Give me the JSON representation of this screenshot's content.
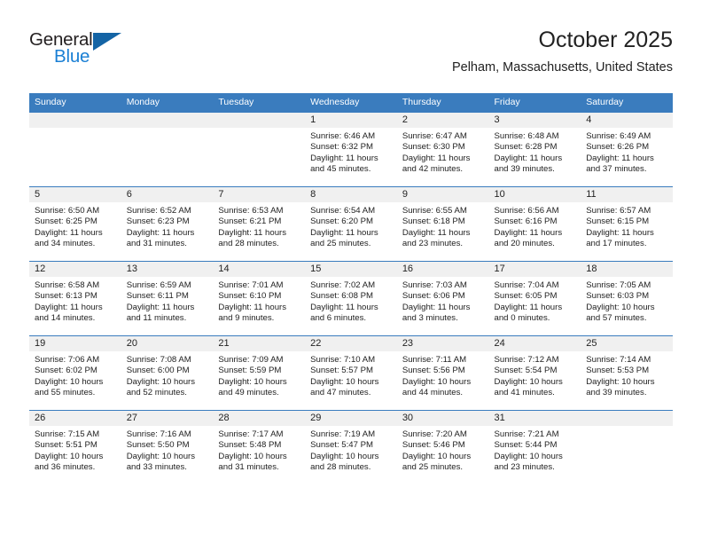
{
  "brand": {
    "name_part1": "General",
    "name_part2": "Blue",
    "triangle_color": "#1464a5",
    "blue_color": "#1a7fd4"
  },
  "header": {
    "title": "October 2025",
    "subtitle": "Pelham, Massachusetts, United States"
  },
  "theme": {
    "header_blue": "#3a7cbe",
    "daynum_band": "#f0f0f0",
    "text": "#222222"
  },
  "weekdays": [
    "Sunday",
    "Monday",
    "Tuesday",
    "Wednesday",
    "Thursday",
    "Friday",
    "Saturday"
  ],
  "weeks": [
    [
      {
        "day": "",
        "blank": true
      },
      {
        "day": "",
        "blank": true
      },
      {
        "day": "",
        "blank": true
      },
      {
        "day": "1",
        "sunrise": "Sunrise: 6:46 AM",
        "sunset": "Sunset: 6:32 PM",
        "daylight1": "Daylight: 11 hours",
        "daylight2": "and 45 minutes."
      },
      {
        "day": "2",
        "sunrise": "Sunrise: 6:47 AM",
        "sunset": "Sunset: 6:30 PM",
        "daylight1": "Daylight: 11 hours",
        "daylight2": "and 42 minutes."
      },
      {
        "day": "3",
        "sunrise": "Sunrise: 6:48 AM",
        "sunset": "Sunset: 6:28 PM",
        "daylight1": "Daylight: 11 hours",
        "daylight2": "and 39 minutes."
      },
      {
        "day": "4",
        "sunrise": "Sunrise: 6:49 AM",
        "sunset": "Sunset: 6:26 PM",
        "daylight1": "Daylight: 11 hours",
        "daylight2": "and 37 minutes."
      }
    ],
    [
      {
        "day": "5",
        "sunrise": "Sunrise: 6:50 AM",
        "sunset": "Sunset: 6:25 PM",
        "daylight1": "Daylight: 11 hours",
        "daylight2": "and 34 minutes."
      },
      {
        "day": "6",
        "sunrise": "Sunrise: 6:52 AM",
        "sunset": "Sunset: 6:23 PM",
        "daylight1": "Daylight: 11 hours",
        "daylight2": "and 31 minutes."
      },
      {
        "day": "7",
        "sunrise": "Sunrise: 6:53 AM",
        "sunset": "Sunset: 6:21 PM",
        "daylight1": "Daylight: 11 hours",
        "daylight2": "and 28 minutes."
      },
      {
        "day": "8",
        "sunrise": "Sunrise: 6:54 AM",
        "sunset": "Sunset: 6:20 PM",
        "daylight1": "Daylight: 11 hours",
        "daylight2": "and 25 minutes."
      },
      {
        "day": "9",
        "sunrise": "Sunrise: 6:55 AM",
        "sunset": "Sunset: 6:18 PM",
        "daylight1": "Daylight: 11 hours",
        "daylight2": "and 23 minutes."
      },
      {
        "day": "10",
        "sunrise": "Sunrise: 6:56 AM",
        "sunset": "Sunset: 6:16 PM",
        "daylight1": "Daylight: 11 hours",
        "daylight2": "and 20 minutes."
      },
      {
        "day": "11",
        "sunrise": "Sunrise: 6:57 AM",
        "sunset": "Sunset: 6:15 PM",
        "daylight1": "Daylight: 11 hours",
        "daylight2": "and 17 minutes."
      }
    ],
    [
      {
        "day": "12",
        "sunrise": "Sunrise: 6:58 AM",
        "sunset": "Sunset: 6:13 PM",
        "daylight1": "Daylight: 11 hours",
        "daylight2": "and 14 minutes."
      },
      {
        "day": "13",
        "sunrise": "Sunrise: 6:59 AM",
        "sunset": "Sunset: 6:11 PM",
        "daylight1": "Daylight: 11 hours",
        "daylight2": "and 11 minutes."
      },
      {
        "day": "14",
        "sunrise": "Sunrise: 7:01 AM",
        "sunset": "Sunset: 6:10 PM",
        "daylight1": "Daylight: 11 hours",
        "daylight2": "and 9 minutes."
      },
      {
        "day": "15",
        "sunrise": "Sunrise: 7:02 AM",
        "sunset": "Sunset: 6:08 PM",
        "daylight1": "Daylight: 11 hours",
        "daylight2": "and 6 minutes."
      },
      {
        "day": "16",
        "sunrise": "Sunrise: 7:03 AM",
        "sunset": "Sunset: 6:06 PM",
        "daylight1": "Daylight: 11 hours",
        "daylight2": "and 3 minutes."
      },
      {
        "day": "17",
        "sunrise": "Sunrise: 7:04 AM",
        "sunset": "Sunset: 6:05 PM",
        "daylight1": "Daylight: 11 hours",
        "daylight2": "and 0 minutes."
      },
      {
        "day": "18",
        "sunrise": "Sunrise: 7:05 AM",
        "sunset": "Sunset: 6:03 PM",
        "daylight1": "Daylight: 10 hours",
        "daylight2": "and 57 minutes."
      }
    ],
    [
      {
        "day": "19",
        "sunrise": "Sunrise: 7:06 AM",
        "sunset": "Sunset: 6:02 PM",
        "daylight1": "Daylight: 10 hours",
        "daylight2": "and 55 minutes."
      },
      {
        "day": "20",
        "sunrise": "Sunrise: 7:08 AM",
        "sunset": "Sunset: 6:00 PM",
        "daylight1": "Daylight: 10 hours",
        "daylight2": "and 52 minutes."
      },
      {
        "day": "21",
        "sunrise": "Sunrise: 7:09 AM",
        "sunset": "Sunset: 5:59 PM",
        "daylight1": "Daylight: 10 hours",
        "daylight2": "and 49 minutes."
      },
      {
        "day": "22",
        "sunrise": "Sunrise: 7:10 AM",
        "sunset": "Sunset: 5:57 PM",
        "daylight1": "Daylight: 10 hours",
        "daylight2": "and 47 minutes."
      },
      {
        "day": "23",
        "sunrise": "Sunrise: 7:11 AM",
        "sunset": "Sunset: 5:56 PM",
        "daylight1": "Daylight: 10 hours",
        "daylight2": "and 44 minutes."
      },
      {
        "day": "24",
        "sunrise": "Sunrise: 7:12 AM",
        "sunset": "Sunset: 5:54 PM",
        "daylight1": "Daylight: 10 hours",
        "daylight2": "and 41 minutes."
      },
      {
        "day": "25",
        "sunrise": "Sunrise: 7:14 AM",
        "sunset": "Sunset: 5:53 PM",
        "daylight1": "Daylight: 10 hours",
        "daylight2": "and 39 minutes."
      }
    ],
    [
      {
        "day": "26",
        "sunrise": "Sunrise: 7:15 AM",
        "sunset": "Sunset: 5:51 PM",
        "daylight1": "Daylight: 10 hours",
        "daylight2": "and 36 minutes."
      },
      {
        "day": "27",
        "sunrise": "Sunrise: 7:16 AM",
        "sunset": "Sunset: 5:50 PM",
        "daylight1": "Daylight: 10 hours",
        "daylight2": "and 33 minutes."
      },
      {
        "day": "28",
        "sunrise": "Sunrise: 7:17 AM",
        "sunset": "Sunset: 5:48 PM",
        "daylight1": "Daylight: 10 hours",
        "daylight2": "and 31 minutes."
      },
      {
        "day": "29",
        "sunrise": "Sunrise: 7:19 AM",
        "sunset": "Sunset: 5:47 PM",
        "daylight1": "Daylight: 10 hours",
        "daylight2": "and 28 minutes."
      },
      {
        "day": "30",
        "sunrise": "Sunrise: 7:20 AM",
        "sunset": "Sunset: 5:46 PM",
        "daylight1": "Daylight: 10 hours",
        "daylight2": "and 25 minutes."
      },
      {
        "day": "31",
        "sunrise": "Sunrise: 7:21 AM",
        "sunset": "Sunset: 5:44 PM",
        "daylight1": "Daylight: 10 hours",
        "daylight2": "and 23 minutes."
      },
      {
        "day": "",
        "blank": true
      }
    ]
  ]
}
